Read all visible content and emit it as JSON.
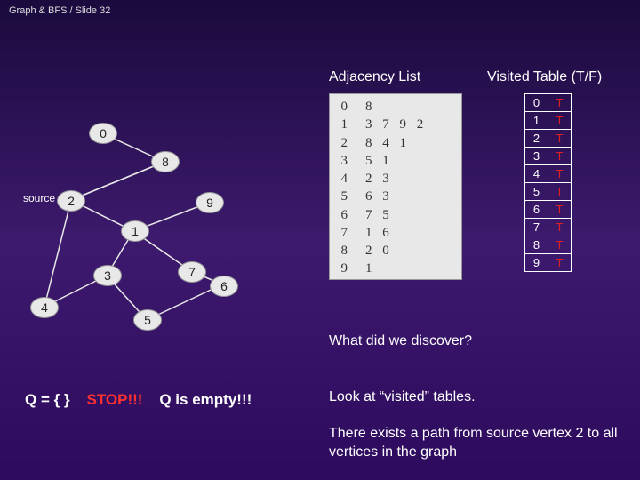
{
  "header": "Graph & BFS / Slide 32",
  "labels": {
    "adjacency": "Adjacency List",
    "visited": "Visited Table (T/F)",
    "source": "source"
  },
  "adjacency": [
    {
      "idx": "0",
      "vals": "8"
    },
    {
      "idx": "1",
      "vals": "3 7 9 2"
    },
    {
      "idx": "2",
      "vals": "8 4 1"
    },
    {
      "idx": "3",
      "vals": "5 1"
    },
    {
      "idx": "4",
      "vals": "2 3"
    },
    {
      "idx": "5",
      "vals": "6 3"
    },
    {
      "idx": "6",
      "vals": "7 5"
    },
    {
      "idx": "7",
      "vals": "1 6"
    },
    {
      "idx": "8",
      "vals": "2 0"
    },
    {
      "idx": "9",
      "vals": "1"
    }
  ],
  "visited": [
    {
      "idx": "0",
      "val": "T"
    },
    {
      "idx": "1",
      "val": "T"
    },
    {
      "idx": "2",
      "val": "T"
    },
    {
      "idx": "3",
      "val": "T"
    },
    {
      "idx": "4",
      "val": "T"
    },
    {
      "idx": "5",
      "val": "T"
    },
    {
      "idx": "6",
      "val": "T"
    },
    {
      "idx": "7",
      "val": "T"
    },
    {
      "idx": "8",
      "val": "T"
    },
    {
      "idx": "9",
      "val": "T"
    }
  ],
  "nodes": {
    "n0": "0",
    "n1": "1",
    "n2": "2",
    "n3": "3",
    "n4": "4",
    "n5": "5",
    "n6": "6",
    "n7": "7",
    "n8": "8",
    "n9": "9"
  },
  "texts": {
    "discover": "What did we discover?",
    "lookat": "Look at “visited” tables.",
    "path": "There exists a path from source vertex 2 to all vertices in the graph",
    "q_prefix": "Q = ",
    "q_set": "{  }",
    "stop": "STOP!!!",
    "qempty": "Q is empty!!!"
  }
}
